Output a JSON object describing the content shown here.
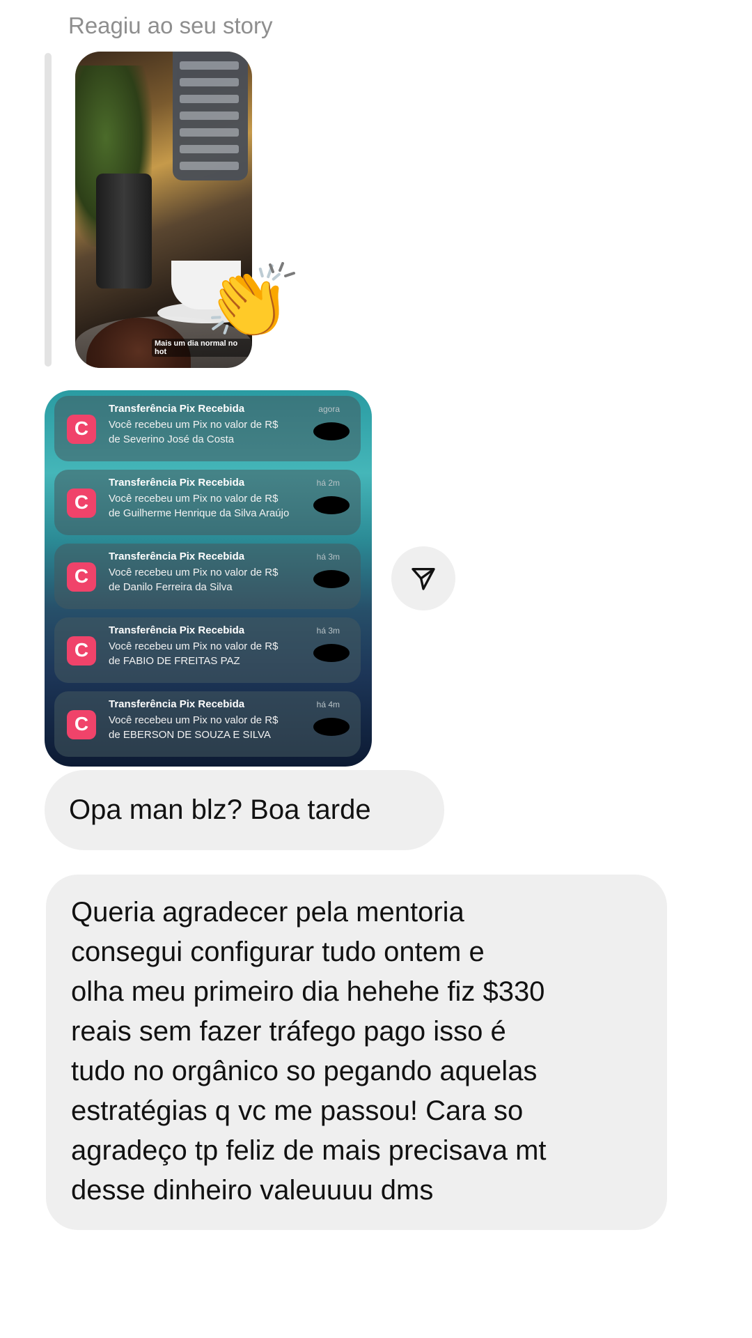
{
  "reaction_label": "Reagiu ao seu story",
  "story": {
    "caption": "Mais um dia normal no hot",
    "reaction_emoji": "👏"
  },
  "pix_notifications": [
    {
      "title": "Transferência Pix Recebida",
      "time": "agora",
      "line1": "Você recebeu um Pix no valor de R$",
      "line2": "de Severino José da Costa"
    },
    {
      "title": "Transferência Pix Recebida",
      "time": "há 2m",
      "line1": "Você recebeu um Pix no valor de R$",
      "line2": "de Guilherme Henrique da Silva Araújo"
    },
    {
      "title": "Transferência Pix Recebida",
      "time": "há 3m",
      "line1": "Você recebeu um Pix no valor de R$",
      "line2": "de Danilo Ferreira da Silva"
    },
    {
      "title": "Transferência Pix Recebida",
      "time": "há 3m",
      "line1": "Você recebeu um Pix no valor de R$",
      "line2": "de FABIO DE FREITAS PAZ"
    },
    {
      "title": "Transferência Pix Recebida",
      "time": "há 4m",
      "line1": "Você recebeu um Pix no valor de R$",
      "line2": "de EBERSON DE SOUZA E SILVA"
    }
  ],
  "messages": {
    "greeting": "Opa man blz? Boa tarde",
    "thanks_lines": [
      "Queria agradecer pela mentoria",
      "consegui configurar tudo ontem e",
      "olha meu primeiro dia hehehe fiz $330",
      "reais sem fazer tráfego pago isso é",
      "tudo no orgânico so pegando aquelas",
      "estratégias q vc me passou! Cara so",
      "agradeço tp feliz de mais precisava mt",
      "desse dinheiro valeuuuu dms"
    ]
  },
  "icons": {
    "share": "paper-plane-icon",
    "pix_app": "app-logo-icon"
  },
  "colors": {
    "bubble": "#efefef",
    "pix_icon": "#f0436a",
    "muted_text": "#8e8e8e"
  }
}
